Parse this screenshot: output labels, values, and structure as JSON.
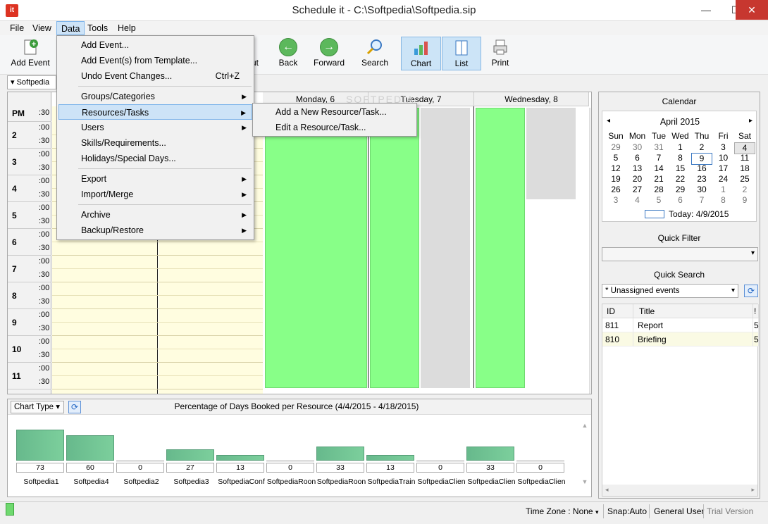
{
  "window": {
    "title": "Schedule it - C:\\Softpedia\\Softpedia.sip",
    "app_icon": "it",
    "minimize": "—",
    "maximize": "☐",
    "close": "✕"
  },
  "menubar": [
    "File",
    "View",
    "Data",
    "Tools",
    "Help"
  ],
  "toolbar": {
    "add_event": "Add Event",
    "zoom_out": "ut",
    "back": "Back",
    "forward": "Forward",
    "search": "Search",
    "chart": "Chart",
    "list": "List",
    "print": "Print"
  },
  "resource_combo": "Softpedia",
  "data_menu": {
    "items": [
      {
        "label": "Add Event...",
        "shortcut": ""
      },
      {
        "label": "Add Event(s) from Template...",
        "shortcut": ""
      },
      {
        "label": "Undo Event Changes...",
        "shortcut": "Ctrl+Z"
      },
      {
        "label": "Groups/Categories",
        "submenu": true
      },
      {
        "label": "Resources/Tasks",
        "submenu": true
      },
      {
        "label": "Users",
        "submenu": true
      },
      {
        "label": "Skills/Requirements...",
        "shortcut": ""
      },
      {
        "label": "Holidays/Special Days...",
        "shortcut": ""
      },
      {
        "label": "Export",
        "submenu": true
      },
      {
        "label": "Import/Merge",
        "submenu": true
      },
      {
        "label": "Archive",
        "submenu": true
      },
      {
        "label": "Backup/Restore",
        "submenu": true
      }
    ],
    "submenu": [
      "Add a New Resource/Task...",
      "Edit a Resource/Task..."
    ]
  },
  "schedule": {
    "pm_label": "PM",
    "first_half": ":30",
    "hours": [
      "2",
      "3",
      "4",
      "5",
      "6",
      "7",
      "8",
      "9",
      "10",
      "11"
    ],
    "minute_labels": [
      ":00",
      ":30"
    ],
    "columns": [
      "Monday, 6",
      "Tuesday, 7",
      "Wednesday, 8"
    ],
    "watermark": "SOFTPEDIA"
  },
  "chart_panel": {
    "chart_type_label": "Chart Type",
    "refresh_icon": "refresh-icon"
  },
  "chart_data": {
    "type": "bar",
    "title": "Percentage of Days Booked per Resource  (4/4/2015 - 4/18/2015)",
    "categories": [
      "Softpedia1",
      "Softpedia4",
      "Softpedia2",
      "Softpedia3",
      "SoftpediaConf",
      "SoftpediaRoon",
      "SoftpediaRoon",
      "SoftpediaTrain",
      "SoftpediaClien",
      "SoftpediaClien",
      "SoftpediaClien"
    ],
    "values": [
      73,
      60,
      0,
      27,
      13,
      0,
      33,
      13,
      0,
      33,
      0
    ],
    "ylim": [
      0,
      100
    ],
    "grid": false,
    "legend": "none"
  },
  "calendar": {
    "title": "Calendar",
    "month": "April 2015",
    "prev": "◂",
    "next": "▸",
    "weekdays": [
      "Sun",
      "Mon",
      "Tue",
      "Wed",
      "Thu",
      "Fri",
      "Sat"
    ],
    "weeks": [
      [
        "29",
        "30",
        "31",
        "1",
        "2",
        "3",
        "4"
      ],
      [
        "5",
        "6",
        "7",
        "8",
        "9",
        "10",
        "11"
      ],
      [
        "12",
        "13",
        "14",
        "15",
        "16",
        "17",
        "18"
      ],
      [
        "19",
        "20",
        "21",
        "22",
        "23",
        "24",
        "25"
      ],
      [
        "26",
        "27",
        "28",
        "29",
        "30",
        "1",
        "2"
      ],
      [
        "3",
        "4",
        "5",
        "6",
        "7",
        "8",
        "9"
      ]
    ],
    "today": "Today: 4/9/2015"
  },
  "quick_filter": {
    "title": "Quick Filter",
    "value": ""
  },
  "quick_search": {
    "title": "Quick Search",
    "value": "* Unassigned events",
    "columns": [
      "ID",
      "Title",
      "!"
    ],
    "rows": [
      {
        "id": "811",
        "title": "Report",
        "flag": "5"
      },
      {
        "id": "810",
        "title": "Briefing",
        "flag": "5"
      }
    ]
  },
  "status": {
    "timezone": "Time Zone : None",
    "snap": "Snap:Auto",
    "user": "General User",
    "version": "Trial Version"
  },
  "colors": {
    "accent": "#cde3f7",
    "bar_green": "#88ff88",
    "chart_bar": "#6cc192"
  }
}
